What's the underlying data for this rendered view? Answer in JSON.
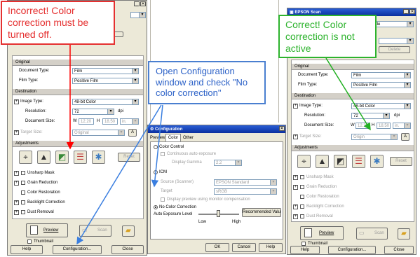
{
  "left": {
    "groups": {
      "original": "Original",
      "destination": "Destination",
      "adjustments": "Adjustments"
    },
    "fields": {
      "document_type_label": "Document Type:",
      "document_type_value": "Film",
      "film_type_label": "Film Type:",
      "film_type_value": "Positive Film",
      "image_type_label": "Image Type:",
      "image_type_value": "48-bit Color",
      "resolution_label": "Resolution:",
      "resolution_value": "72",
      "dpi": "dpi",
      "document_size_label": "Document Size:",
      "w_label": "W",
      "w_value": "12.20",
      "h_label": "H",
      "h_value": "18.50",
      "unit": "in.",
      "target_size_label": "Target Size:",
      "target_size_value": "Original"
    },
    "reset": "Reset",
    "checks": [
      "Unsharp Mask",
      "Grain Reduction",
      "Color Restoration",
      "Backlight Correction",
      "Dust Removal"
    ],
    "buttons": {
      "preview": "Preview",
      "scan": "Scan",
      "thumbnail": "Thumbnail",
      "help": "Help",
      "configuration": "Configuration...",
      "close": "Close"
    }
  },
  "config": {
    "title": "Configuration",
    "tabs": [
      "Preview",
      "Color",
      "Other"
    ],
    "color_control": "Color Control",
    "continuous": "Continuous auto exposure",
    "display_gamma_label": "Display Gamma",
    "display_gamma_value": "2.2",
    "icm": "ICM",
    "source_label": "Source (Scanner)",
    "source_value": "EPSON Standard",
    "target_label": "Target",
    "target_value": "sRGB",
    "display_preview": "Display preview using monitor compensation",
    "no_color": "No Color Correction",
    "auto_exposure": "Auto Exposure Level",
    "low": "Low",
    "high": "High",
    "recommended": "Recommended Value",
    "ok": "OK",
    "cancel": "Cancel",
    "help": "Help"
  },
  "right": {
    "title": "EPSON Scan",
    "mode_value": "al Mode",
    "delete": "Delete",
    "groups": {
      "original": "Original",
      "destination": "Destination",
      "adjustments": "Adjustments"
    },
    "fields": {
      "document_type_label": "Document Type:",
      "document_type_value": "Film",
      "film_type_label": "Film Type:",
      "film_type_value": "Positive Film",
      "image_type_label": "Image Type:",
      "image_type_value": "48-bit Color",
      "resolution_label": "Resolution:",
      "resolution_value": "72",
      "dpi": "dpi",
      "document_size_label": "Document Size:",
      "w_label": "W",
      "w_value": "12.20",
      "h_label": "H",
      "h_value": "18.50",
      "unit": "in.",
      "target_size_label": "Target Size:",
      "target_size_value": "Origin"
    },
    "reset": "Reset",
    "checks": [
      "Unsharp Mask",
      "Grain Reduction",
      "Color Restoration",
      "Backlight Correction",
      "Dust Removal"
    ],
    "buttons": {
      "preview": "Preview",
      "scan": "Scan",
      "thumbnail": "Thumbnail",
      "help": "Help",
      "configuration": "Configuration...",
      "close": "Close"
    }
  },
  "callouts": {
    "incorrect": "Incorrect! Color correction must be turned off.",
    "open_config": "Open Configuration window and check \"No color correction\"",
    "correct": "Correct!  Color correction is not active"
  },
  "colors": {
    "incorrect_border": "#E53030",
    "incorrect_text": "#E53030",
    "config_border": "#4A7FD0",
    "config_text": "#2E63C8",
    "correct_border": "#2DB32D",
    "correct_text": "#2DB32D",
    "red_arrow": "#FF0000",
    "blue_arrow": "#3B7FE0",
    "green_arrow": "#22B022"
  },
  "icons": [
    "auto-exposure-icon",
    "histogram-icon",
    "tone-correction-icon",
    "image-adjustment-icon",
    "color-palette-icon"
  ]
}
